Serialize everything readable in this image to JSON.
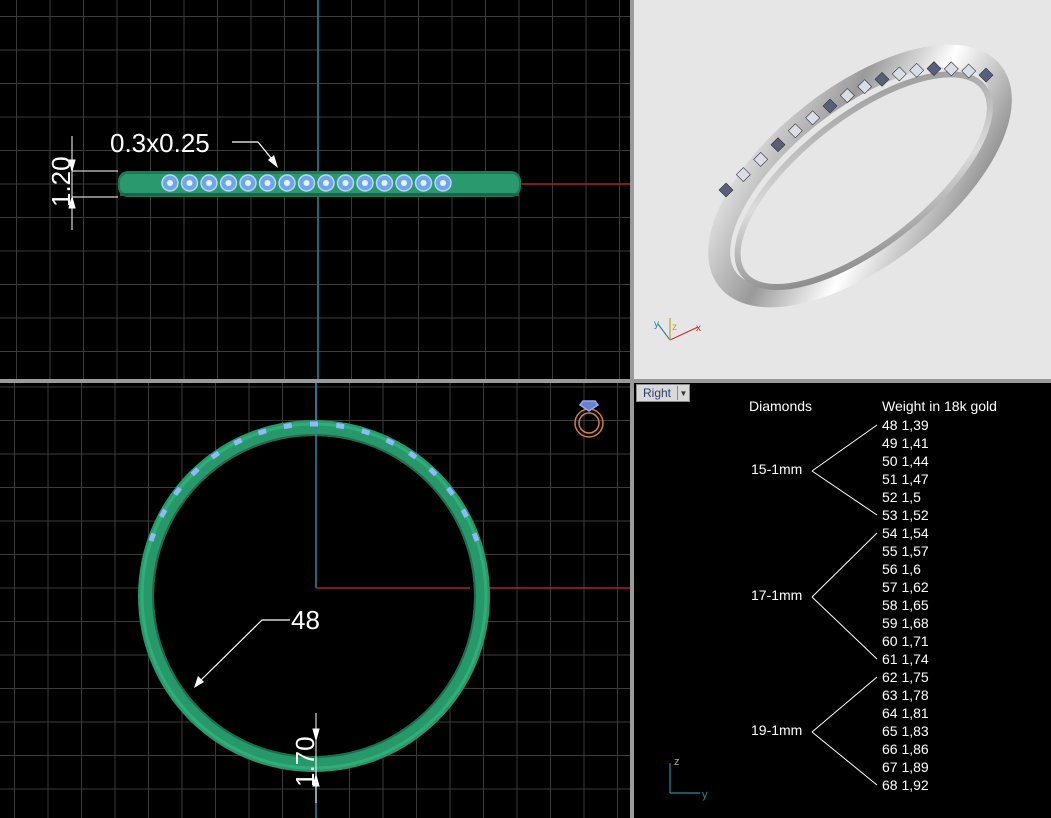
{
  "dimensions": {
    "stone_size": "0.3x0.25",
    "band_height": "1.20",
    "ring_size": "48",
    "band_thickness": "1.70"
  },
  "viewport_right": {
    "label": "Right"
  },
  "axes": {
    "persp_x": "x",
    "persp_y": "y",
    "persp_z": "z",
    "right_z": "z",
    "right_y": "y"
  },
  "table": {
    "col_diamonds": "Diamonds",
    "col_weight": "Weight in 18k gold",
    "groups": [
      {
        "diamonds": "15-1mm",
        "rows": [
          "48 1,39",
          "49 1,41",
          "50 1,44",
          "51 1,47",
          "52 1,5",
          "53 1,52"
        ]
      },
      {
        "diamonds": "17-1mm",
        "rows": [
          "54 1,54",
          "55 1,57",
          "56 1,6",
          "57 1,62",
          "58 1,65",
          "59 1,68",
          "60 1,71",
          "61 1,74"
        ]
      },
      {
        "diamonds": "19-1mm",
        "rows": [
          "62 1,75",
          "63 1,78",
          "64 1,81",
          "65 1,83",
          "66 1,86",
          "67 1,89",
          "68 1,92"
        ]
      }
    ]
  },
  "colors": {
    "band_green": "#2a9a6e",
    "stone_blue": "#8fb8ff",
    "grid": "#3a3a3a",
    "axis_x": "#b52020",
    "axis_y": "#2a8aa0"
  }
}
